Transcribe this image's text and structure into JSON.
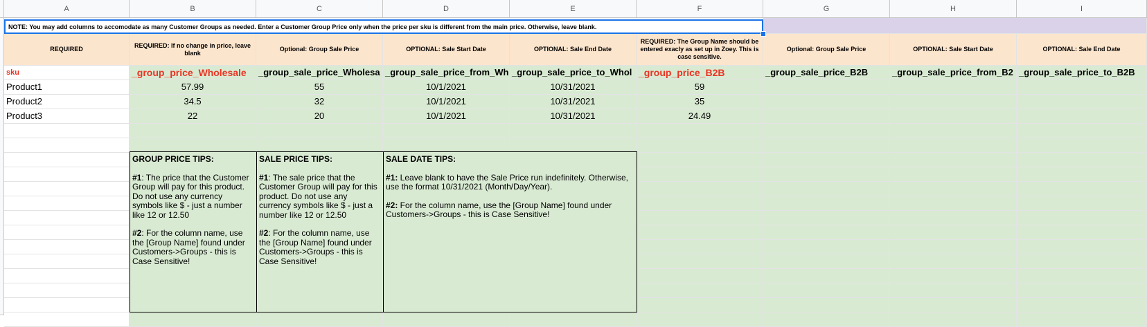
{
  "columns": [
    "A",
    "B",
    "C",
    "D",
    "E",
    "F",
    "G",
    "H",
    "I"
  ],
  "note": "NOTE: You may add columns to accomodate as many Customer Groups as needed. Enter a Customer Group Price only when the price per sku is different from the main price. Otherwise, leave blank.",
  "row3": [
    "REQUIRED",
    "REQUIRED: If no change in price, leave blank",
    "Optional: Group Sale Price",
    "OPTIONAL: Sale Start Date",
    "OPTIONAL: Sale End Date",
    "REQUIRED: The Group Name should be entered exacly as set up in Zoey. This is case sensitive.",
    "Optional: Group Sale Price",
    "OPTIONAL: Sale Start Date",
    "OPTIONAL: Sale End Date"
  ],
  "row4": [
    "sku",
    "_group_price_Wholesale",
    "_group_sale_price_Wholesa",
    "_group_sale_price_from_Wh",
    "_group_sale_price_to_Whol",
    "_group_price_B2B",
    "_group_sale_price_B2B",
    "_group_sale_price_from_B2",
    "_group_sale_price_to_B2B"
  ],
  "products": [
    {
      "sku": "Product1",
      "group_price": "57.99",
      "sale_price": "55",
      "from": "10/1/2021",
      "to": "10/31/2021",
      "b2b": "59"
    },
    {
      "sku": "Product2",
      "group_price": "34.5",
      "sale_price": "32",
      "from": "10/1/2021",
      "to": "10/31/2021",
      "b2b": "35"
    },
    {
      "sku": "Product3",
      "group_price": "22",
      "sale_price": "20",
      "from": "10/1/2021",
      "to": "10/31/2021",
      "b2b": "24.49"
    }
  ],
  "tips": {
    "group": {
      "title": "GROUP PRICE TIPS:",
      "tip1_label": "#1",
      "tip1": ": The price that the Customer Group will pay for this product. Do not use any currency symbols like $ - just a number like 12 or 12.50",
      "tip2_label": "#2",
      "tip2": ": For the column name, use the [Group Name] found under Customers->Groups - this is Case Sensitive!"
    },
    "sale": {
      "title": "SALE PRICE TIPS:",
      "tip1_label": "#1",
      "tip1": ": The sale price that the Customer Group will pay for this product. Do not use any currency symbols like $ - just a number like 12 or 12.50",
      "tip2_label": "#2",
      "tip2": ": For the column name, use the [Group Name] found under Customers->Groups - this is Case Sensitive!"
    },
    "date": {
      "title": "SALE DATE TIPS:",
      "tip1_label": "#1:",
      "tip1": " Leave blank to have the Sale Price run indefinitely. Otherwise, use the format 10/31/2021 (Month/Day/Year).",
      "tip2_label": "#2:",
      "tip2": " For the column name, use the [Group Name] found under Customers->Groups - this is Case Sensitive!"
    }
  },
  "colors": {
    "green": "#d9ead3",
    "purple": "#d9d2e9",
    "peach": "#fce5cd",
    "red_text": "#ea3323",
    "selection": "#1a73e8"
  }
}
